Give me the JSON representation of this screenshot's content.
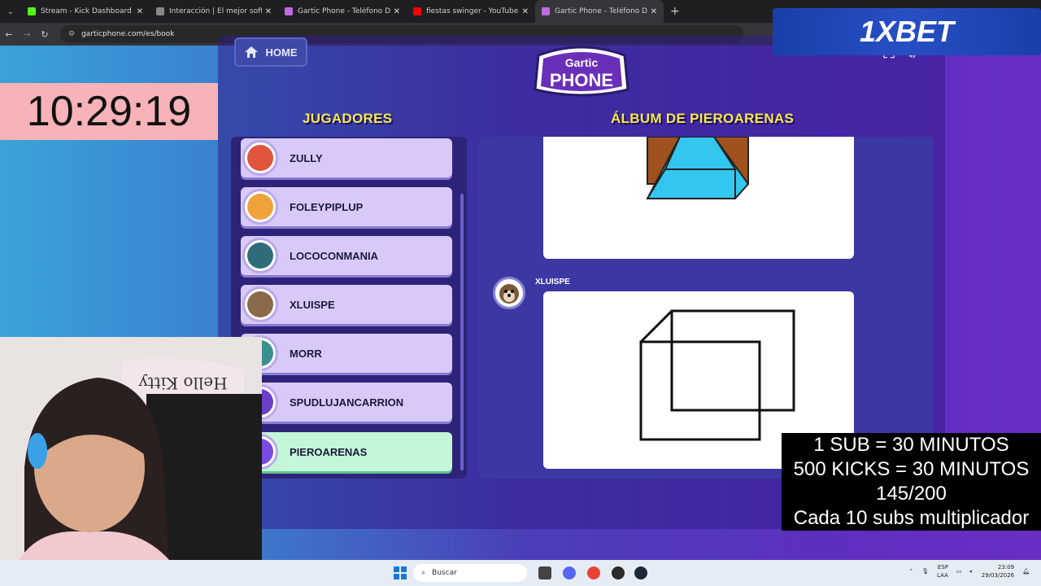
{
  "browser": {
    "tabs": [
      {
        "title": "Stream - Kick Dashboard",
        "color": "#53fc18"
      },
      {
        "title": "Interacción | El mejor softw",
        "color": "#888888"
      },
      {
        "title": "Gartic Phone - Teléfono Descon",
        "color": "#c06be0"
      },
      {
        "title": "fiestas swinger - YouTube",
        "color": "#ff0000"
      },
      {
        "title": "Gartic Phone - Teléfono Descon",
        "color": "#c06be0"
      }
    ],
    "url": "garticphone.com/es/book"
  },
  "overlays": {
    "timer": "10:29:19",
    "ad_text": "1XBET",
    "sub_lines": [
      "1 SUB      = 30 MINUTOS",
      "500 KICKS = 30 MINUTOS",
      "145/200",
      "Cada 10 subs multiplicador"
    ]
  },
  "game": {
    "home_label": "HOME",
    "logo_top": "Gartic",
    "logo_bottom": "PHONE",
    "players_heading": "JUGADORES",
    "album_heading": "ÁLBUM DE PIEROARENAS",
    "players": [
      {
        "name": "ZULLY",
        "color": "#e0553b"
      },
      {
        "name": "FOLEYPIPLUP",
        "color": "#f0a23a"
      },
      {
        "name": "LOCOCONMANIA",
        "color": "#2f6b7a"
      },
      {
        "name": "XLUISPE",
        "color": "#8a6a4a"
      },
      {
        "name": "MORR",
        "color": "#3b8f8f"
      },
      {
        "name": "SPUDLUJANCARRION",
        "color": "#6b3fc6"
      },
      {
        "name": "PIEROARENAS",
        "color": "#7a4be0"
      }
    ],
    "active_player": "PIEROARENAS",
    "author": "XLUISPE"
  },
  "taskbar": {
    "search_placeholder": "Buscar",
    "lang_top": "ESP",
    "lang_bottom": "LAA",
    "time": "23:09",
    "date": "29/03/2026"
  }
}
